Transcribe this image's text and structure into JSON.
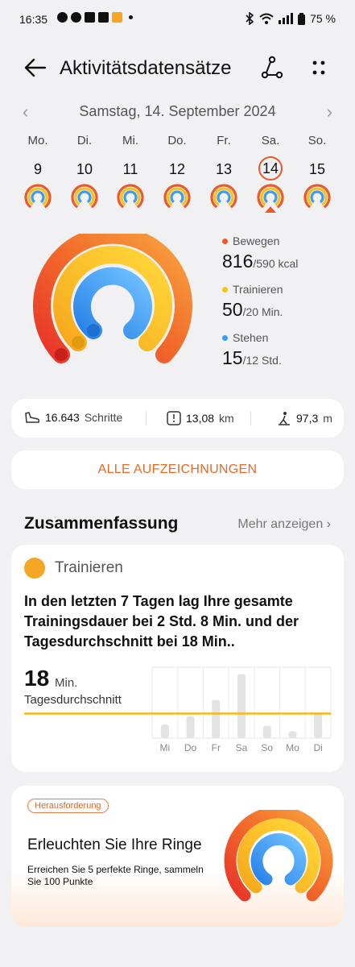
{
  "status": {
    "time": "16:35",
    "battery": "75 %"
  },
  "header": {
    "title": "Aktivitätsdatensätze"
  },
  "date": {
    "label": "Samstag, 14. September 2024"
  },
  "week": [
    {
      "day": "Mo.",
      "num": "9"
    },
    {
      "day": "Di.",
      "num": "10"
    },
    {
      "day": "Mi.",
      "num": "11"
    },
    {
      "day": "Do.",
      "num": "12"
    },
    {
      "day": "Fr.",
      "num": "13"
    },
    {
      "day": "Sa.",
      "num": "14",
      "selected": true
    },
    {
      "day": "So.",
      "num": "15"
    }
  ],
  "colors": {
    "move": "#ea5a2a",
    "exercise": "#f7c21c",
    "stand": "#3d9bf0",
    "accent": "#e8682a"
  },
  "rings": {
    "move": {
      "label": "Bewegen",
      "value": "816",
      "goal": "/590 kcal",
      "progress": 1.38
    },
    "exercise": {
      "label": "Trainieren",
      "value": "50",
      "goal": "/20 Min.",
      "progress": 2.5
    },
    "stand": {
      "label": "Stehen",
      "value": "15",
      "goal": "/12 Std.",
      "progress": 1.25
    }
  },
  "stats": {
    "steps_value": "16.643",
    "steps_unit": "Schritte",
    "distance_value": "13,08",
    "distance_unit": "km",
    "climb_value": "97,3",
    "climb_unit": "m"
  },
  "all_records_button": "ALLE AUFZEICHNUNGEN",
  "summary": {
    "heading": "Zusammenfassung",
    "more": "Mehr anzeigen",
    "card_label": "Trainieren",
    "text": "In den letzten 7 Tagen lag Ihre gesamte Trainingsdauer bei 2 Std. 8 Min. und der Tagesdurchschnitt bei 18 Min..",
    "avg_value": "18",
    "avg_unit": "Min.",
    "avg_label": "Tagesdurchschnitt"
  },
  "chart_data": {
    "type": "bar",
    "categories": [
      "Mi",
      "Do",
      "Fr",
      "Sa",
      "So",
      "Mo",
      "Di"
    ],
    "values": [
      10,
      16,
      28,
      47,
      9,
      5,
      18
    ],
    "average_line": 18,
    "ylim": [
      0,
      52
    ]
  },
  "promo": {
    "badge": "Herausforderung",
    "title": "Erleuchten Sie Ihre Ringe",
    "subtitle": "Erreichen Sie 5 perfekte Ringe, sammeln Sie 100 Punkte"
  }
}
